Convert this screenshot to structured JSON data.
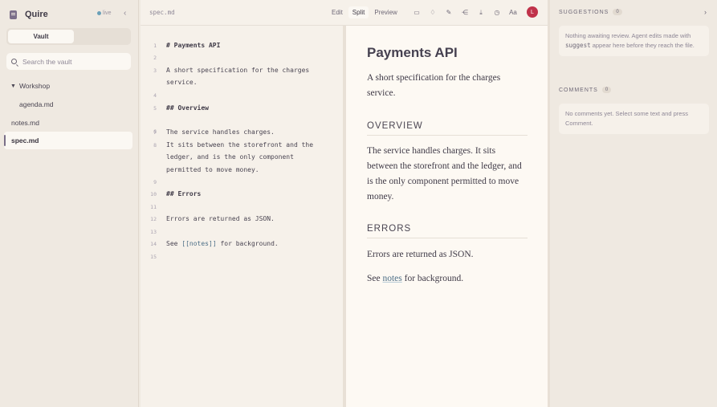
{
  "app": {
    "name": "Quire",
    "status": "live"
  },
  "sidebar": {
    "tabs": [
      "Vault"
    ],
    "search_placeholder": "Search the vault",
    "folder": {
      "name": "Workshop",
      "children": [
        "agenda.md"
      ]
    },
    "files": [
      "notes.md",
      "spec.md"
    ],
    "active_file": "spec.md"
  },
  "editor": {
    "filename": "spec.md",
    "modes": [
      "Edit",
      "Split",
      "Preview"
    ],
    "active_mode": "Split",
    "avatar_initial": "L",
    "lines": [
      {
        "n": "1",
        "text": "# Payments API"
      },
      {
        "n": "2",
        "text": ""
      },
      {
        "n": "3",
        "text": "A short specification for the charges"
      },
      {
        "n": "",
        "text": "service."
      },
      {
        "n": "4",
        "text": ""
      },
      {
        "n": "5",
        "text": "## Overview"
      },
      {
        "n": "6",
        "text": ""
      },
      {
        "n": "7",
        "text": "The service handles charges."
      },
      {
        "n": "8",
        "text": "It sits between the storefront and the"
      },
      {
        "n": "",
        "text": "ledger, and is the only component"
      },
      {
        "n": "",
        "text": "permitted to move money."
      },
      {
        "n": "9",
        "text": ""
      },
      {
        "n": "10",
        "text": "## Errors"
      },
      {
        "n": "11",
        "text": ""
      },
      {
        "n": "12",
        "text": "Errors are returned as JSON."
      },
      {
        "n": "13",
        "text": ""
      },
      {
        "n": "14",
        "text": "See [[notes]] for background."
      },
      {
        "n": "15",
        "text": ""
      }
    ],
    "link_line": {
      "before": "See ",
      "open": "[[",
      "link": "notes",
      "close": "]]",
      "after": " for background."
    }
  },
  "preview": {
    "title": "Payments API",
    "intro": "A short specification for the charges service.",
    "h_overview": "OVERVIEW",
    "overview_text": "The service handles charges. It sits between the storefront and the ledger, and is the only component permitted to move money.",
    "h_errors": "ERRORS",
    "errors_text": "Errors are returned as JSON.",
    "see_before": "See ",
    "see_link": "notes",
    "see_after": " for background."
  },
  "panel": {
    "suggestions_title": "SUGGESTIONS",
    "suggestions_count": "0",
    "suggestions_text_1": "Nothing awaiting review. Agent edits made with ",
    "suggestions_code": "suggest",
    "suggestions_text_2": " appear here before they reach the file.",
    "comments_title": "COMMENTS",
    "comments_count": "0",
    "comments_text": "No comments yet. Select some text and press Comment."
  }
}
